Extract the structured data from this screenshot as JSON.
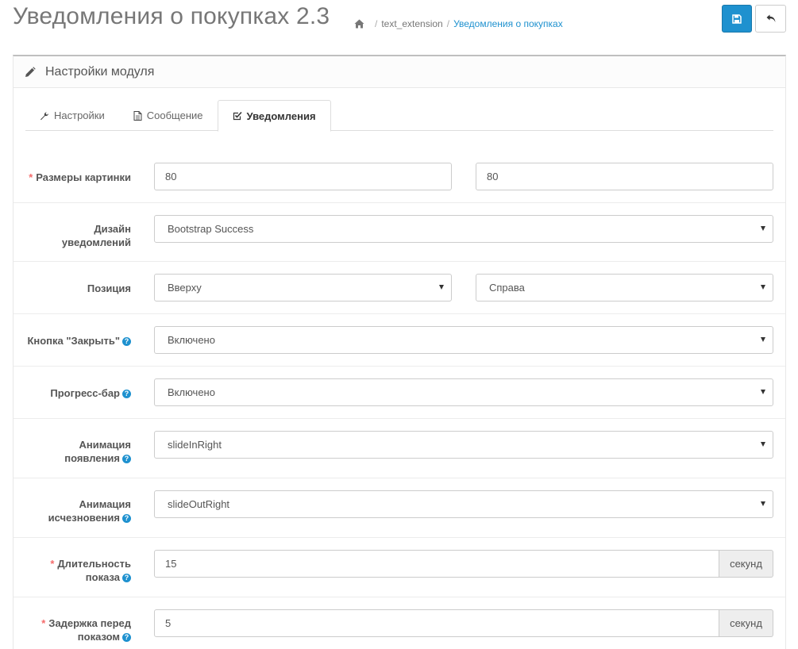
{
  "header": {
    "title": "Уведомления о покупках 2.3",
    "breadcrumbs": [
      "text_extension",
      "Уведомления о покупках"
    ]
  },
  "panel": {
    "heading": "Настройки модуля"
  },
  "tabs": [
    {
      "label": "Настройки",
      "icon": "wrench-icon",
      "active": false
    },
    {
      "label": "Сообщение",
      "icon": "file-text-icon",
      "active": false
    },
    {
      "label": "Уведомления",
      "icon": "check-square-icon",
      "active": true
    }
  ],
  "form": {
    "image_size": {
      "label": "Размеры картинки",
      "required": true,
      "width": "80",
      "height": "80"
    },
    "design": {
      "label_line1": "Дизайн",
      "label_line2": "уведомлений",
      "value": "Bootstrap Success"
    },
    "position": {
      "label": "Позиция",
      "vertical": "Вверху",
      "horizontal": "Справа"
    },
    "close_button": {
      "label": "Кнопка \"Закрыть\"",
      "value": "Включено"
    },
    "progress_bar": {
      "label": "Прогресс-бар",
      "value": "Включено"
    },
    "animation_in": {
      "label_line1": "Анимация",
      "label_line2": "появления",
      "value": "slideInRight"
    },
    "animation_out": {
      "label_line1": "Анимация",
      "label_line2": "исчезновения",
      "value": "slideOutRight"
    },
    "duration": {
      "label_line1": "Длительность",
      "label_line2": "показа",
      "required": true,
      "value": "15",
      "unit": "секунд"
    },
    "delay": {
      "label_line1": "Задержка перед",
      "label_line2": "показом",
      "required": true,
      "value": "5",
      "unit": "секунд"
    }
  },
  "colors": {
    "primary": "#1e91cf",
    "required": "#f56b6b",
    "active_crumb": "#1e91cf"
  },
  "help_glyph": "?",
  "required_glyph": "*"
}
